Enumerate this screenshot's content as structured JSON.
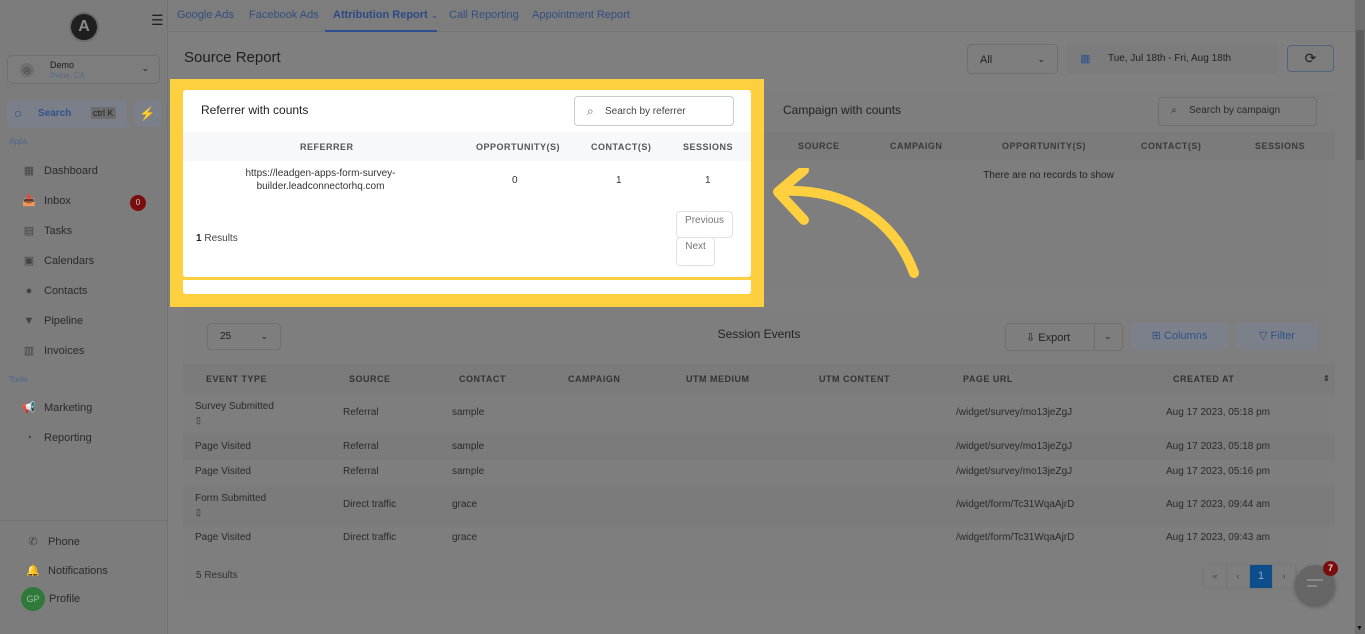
{
  "sidebar": {
    "logo_letter": "A",
    "location": {
      "name": "Demo",
      "city": "Irvine, CA"
    },
    "search": {
      "label": "Search",
      "shortcut": "ctrl K"
    },
    "apps_label": "Apps",
    "tools_label": "Tools",
    "apps": [
      {
        "label": "Dashboard",
        "icon": "dashboard-icon"
      },
      {
        "label": "Inbox",
        "icon": "inbox-icon",
        "badge": "0"
      },
      {
        "label": "Tasks",
        "icon": "tasks-icon"
      },
      {
        "label": "Calendars",
        "icon": "calendar-icon"
      },
      {
        "label": "Contacts",
        "icon": "contacts-icon"
      },
      {
        "label": "Pipeline",
        "icon": "pipeline-icon"
      },
      {
        "label": "Invoices",
        "icon": "invoices-icon"
      }
    ],
    "tools": [
      {
        "label": "Marketing",
        "icon": "megaphone-icon"
      },
      {
        "label": "Reporting",
        "icon": "pie-chart-icon"
      }
    ],
    "bottom": {
      "phone": "Phone",
      "notifications": "Notifications",
      "profile": "Profile",
      "profile_initials": "GP"
    }
  },
  "topnav": {
    "tabs": [
      "Google Ads",
      "Facebook Ads",
      "Attribution Report",
      "Call Reporting",
      "Appointment Report"
    ],
    "active": "Attribution Report"
  },
  "header": {
    "title": "Source Report",
    "filter_value": "All",
    "date_range": "Tue, Jul 18th - Fri, Aug 18th"
  },
  "referrer_card": {
    "title": "Referrer with counts",
    "search_placeholder": "Search by referrer",
    "columns": [
      "REFERRER",
      "OPPORTUNITY(S)",
      "CONTACT(S)",
      "SESSIONS"
    ],
    "rows": [
      {
        "referrer_line1": "https://leadgen-apps-form-survey-",
        "referrer_line2": "builder.leadconnectorhq.com",
        "opportunities": "0",
        "contacts": "1",
        "sessions": "1"
      }
    ],
    "results_count": "1",
    "results_label": "Results",
    "prev_label": "Previous",
    "next_label": "Next"
  },
  "campaign_card": {
    "title": "Campaign with counts",
    "search_placeholder": "Search by campaign",
    "columns": [
      "SOURCE",
      "CAMPAIGN",
      "OPPORTUNITY(S)",
      "CONTACT(S)",
      "SESSIONS"
    ],
    "empty_text": "There are no records to show"
  },
  "session_events": {
    "title": "Session Events",
    "per_page": "25",
    "export_label": "Export",
    "columns_label": "Columns",
    "filter_label": "Filter",
    "columns": [
      "EVENT TYPE",
      "SOURCE",
      "CONTACT",
      "CAMPAIGN",
      "UTM MEDIUM",
      "UTM CONTENT",
      "PAGE URL",
      "CREATED AT"
    ],
    "rows": [
      {
        "event": "Survey Submitted",
        "has_icon": true,
        "source": "Referral",
        "contact": "sample",
        "url": "/widget/survey/mo13jeZgJ",
        "created": "Aug 17 2023, 05:18 pm"
      },
      {
        "event": "Page Visited",
        "has_icon": false,
        "source": "Referral",
        "contact": "sample",
        "url": "/widget/survey/mo13jeZgJ",
        "created": "Aug 17 2023, 05:18 pm"
      },
      {
        "event": "Page Visited",
        "has_icon": false,
        "source": "Referral",
        "contact": "sample",
        "url": "/widget/survey/mo13jeZgJ",
        "created": "Aug 17 2023, 05:16 pm"
      },
      {
        "event": "Form Submitted",
        "has_icon": true,
        "source": "Direct traffic",
        "contact": "grace",
        "url": "/widget/form/Tc31WqaAjrD",
        "created": "Aug 17 2023, 09:44 am"
      },
      {
        "event": "Page Visited",
        "has_icon": false,
        "source": "Direct traffic",
        "contact": "grace",
        "url": "/widget/form/Tc31WqaAjrD",
        "created": "Aug 17 2023, 09:43 am"
      }
    ],
    "results_label": "5 Results",
    "pagination": {
      "first": "«",
      "prev": "‹",
      "current": "1",
      "next": "›"
    }
  },
  "chat_widget": {
    "badge": "7"
  },
  "colors": {
    "highlight": "#fecf3e",
    "accent": "#2f4f8f",
    "badge_red": "#7a0e0e"
  }
}
